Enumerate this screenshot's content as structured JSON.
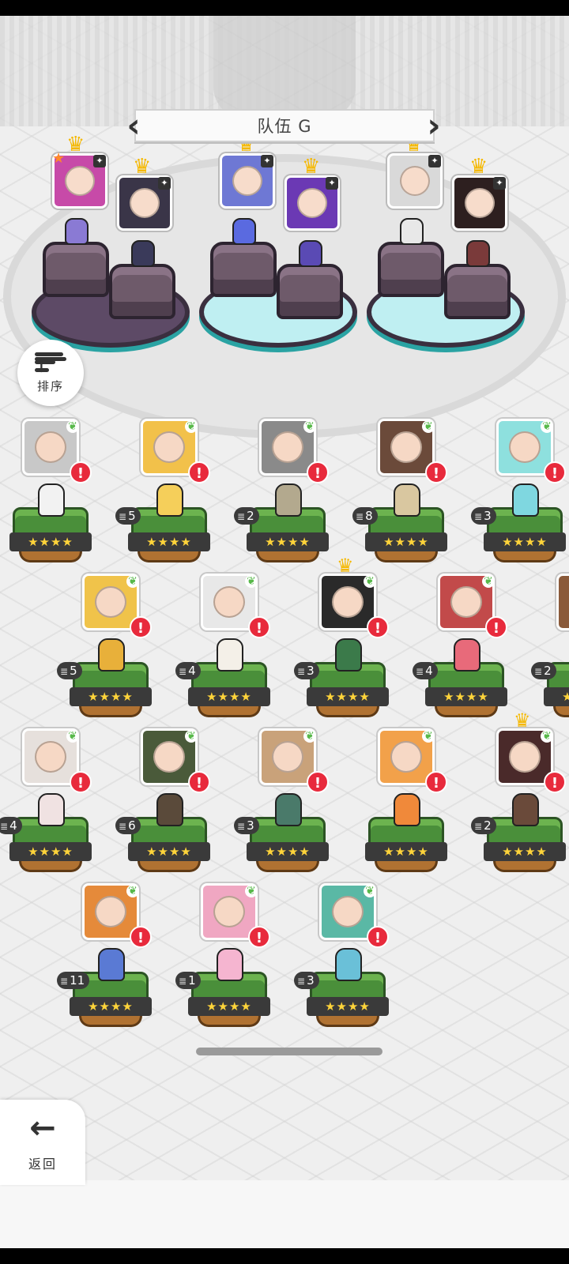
{
  "team": {
    "title": "队伍 G",
    "prev_icon": "chevron-left-icon",
    "next_icon": "chevron-right-icon",
    "slot_colors": [
      "#c74aa8",
      "#3a3548",
      "#6e78d4",
      "#6b39b4",
      "#d9d9d9",
      "#2d1f1f"
    ]
  },
  "sort": {
    "label": "排序",
    "icon": "sort-icon"
  },
  "back": {
    "label": "返回",
    "icon": "arrow-left-icon"
  },
  "colors": {
    "alert": "#e82a3c",
    "crown": "#f5b800",
    "grass": "#4a8f3a",
    "stars": "#ffd43a"
  },
  "heroes": [
    {
      "level": "",
      "stars": "★★★★",
      "color": "#c8c8c8",
      "sprite": "#f2f2f2",
      "crown": false
    },
    {
      "level": "5",
      "stars": "★★★★",
      "color": "#f2c14a",
      "sprite": "#f5cf5a",
      "crown": false
    },
    {
      "level": "2",
      "stars": "★★★★",
      "color": "#8a8a8a",
      "sprite": "#b3a98e",
      "crown": false
    },
    {
      "level": "8",
      "stars": "★★★★",
      "color": "#6b4a3a",
      "sprite": "#d9c7a0",
      "crown": false
    },
    {
      "level": "3",
      "stars": "★★★★",
      "color": "#8ee0de",
      "sprite": "#7fd7e0",
      "crown": false
    },
    {
      "level": "5",
      "stars": "★★★★",
      "color": "#f0c34a",
      "sprite": "#e8b03a",
      "crown": false
    },
    {
      "level": "4",
      "stars": "★★★★",
      "color": "#e8e8e8",
      "sprite": "#f4f0e8",
      "crown": false
    },
    {
      "level": "3",
      "stars": "★★★★",
      "color": "#2a2a2a",
      "sprite": "#3b7a4a",
      "crown": true
    },
    {
      "level": "4",
      "stars": "★★★★",
      "color": "#c24a4a",
      "sprite": "#e86a7a",
      "crown": false
    },
    {
      "level": "2",
      "stars": "★★★★",
      "color": "#8a5a3a",
      "sprite": "#f2f2f2",
      "crown": false
    },
    {
      "level": "4",
      "stars": "★★★★",
      "color": "#e6e0dc",
      "sprite": "#f0e2e2",
      "crown": false
    },
    {
      "level": "6",
      "stars": "★★★★",
      "color": "#4a5a3a",
      "sprite": "#5a4a3a",
      "crown": false
    },
    {
      "level": "3",
      "stars": "★★★★",
      "color": "#c9a27a",
      "sprite": "#4a7a6a",
      "crown": false
    },
    {
      "level": "",
      "stars": "★★★★",
      "color": "#f2a14a",
      "sprite": "#f0893a",
      "crown": false
    },
    {
      "level": "2",
      "stars": "★★★★",
      "color": "#4a2a2a",
      "sprite": "#6a4a3a",
      "crown": true
    },
    {
      "level": "11",
      "stars": "★★★★",
      "color": "#e58a3a",
      "sprite": "#5a7ad4",
      "crown": false
    },
    {
      "level": "1",
      "stars": "★★★★",
      "color": "#f0a7c2",
      "sprite": "#f5b5d0",
      "crown": false
    },
    {
      "level": "3",
      "stars": "★★★★",
      "color": "#5ab8a5",
      "sprite": "#6ac0d8",
      "crown": false
    }
  ]
}
